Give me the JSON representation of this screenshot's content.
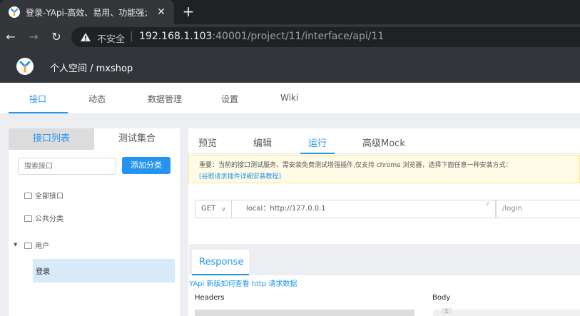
{
  "browser": {
    "tab_title": "登录-YApi-高效、易用、功能强大",
    "close_glyph": "✕",
    "new_tab_glyph": "+",
    "back_glyph": "←",
    "forward_glyph": "→",
    "reload_glyph": "↻",
    "insecure_label": "不安全",
    "separator": "|",
    "url_host": "192.168.1.103",
    "url_rest": ":40001/project/11/interface/api/11"
  },
  "header": {
    "breadcrumb": "个人空间 / mxshop"
  },
  "subnav": {
    "items": [
      "接口",
      "动态",
      "数据管理",
      "设置",
      "Wiki"
    ],
    "active_index": 0
  },
  "left": {
    "tabs": [
      "接口列表",
      "测试集合"
    ],
    "active_tab": 0,
    "search_placeholder": "搜索接口",
    "add_category_label": "添加分类",
    "tree": [
      {
        "label": "全部接口",
        "icon": "folder-icon"
      },
      {
        "label": "公共分类",
        "icon": "folder-icon"
      },
      {
        "label": "用户",
        "icon": "folder-icon",
        "expanded": true,
        "caret": "▼"
      }
    ],
    "selected_item": "登录"
  },
  "right": {
    "tabs": [
      "预览",
      "编辑",
      "运行",
      "高级Mock"
    ],
    "active_tab": 2,
    "notice_text": "重要：当前的接口测试服务，需安装免费测试增强插件,仅支持 chrome 浏览器，选择下面任意一种安装方式：",
    "notice_link": "[谷歌请求插件详细安装教程]",
    "request": {
      "method": "GET",
      "method_chevron": "∨",
      "host": "local：http://127.0.0.1",
      "host_chevron": "∨",
      "path": "/login"
    },
    "response": {
      "tab_label": "Response",
      "help_link": "YApi 新版如何查看 http 请求数据",
      "headers_label": "Headers",
      "body_label": "Body",
      "body_line_number": "1"
    }
  },
  "colors": {
    "accent": "#2395f1",
    "header_bg": "#32363a",
    "browser_bg": "#202124",
    "notice_bg": "#fffbe6"
  }
}
